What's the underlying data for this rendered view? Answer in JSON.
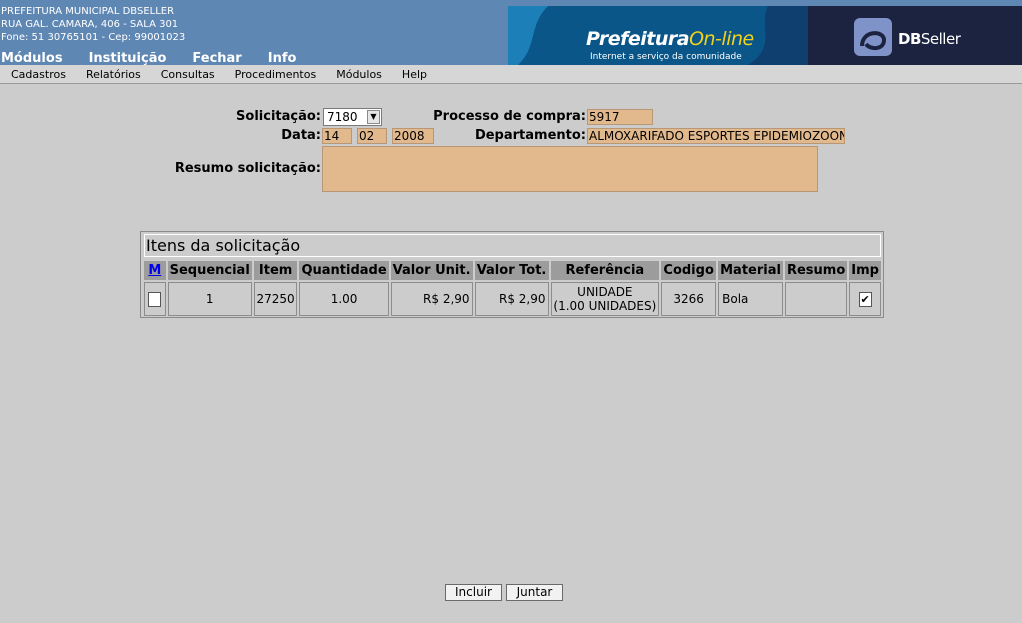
{
  "header": {
    "org_lines": [
      "PREFEITURA MUNICIPAL DBSELLER",
      "RUA GAL. CAMARA, 406 - SALA 301",
      "Fone: 51 30765101  -  Cep: 99001023"
    ],
    "nav": [
      "Módulos",
      "Instituição",
      "Fechar",
      "Info"
    ],
    "banner_title_main": "Prefeitura",
    "banner_title_accent": "On-line",
    "banner_subtitle": "Internet a serviço da comunidade",
    "brand_db": "DB",
    "brand_seller": "Seller"
  },
  "menu": [
    "Cadastros",
    "Relatórios",
    "Consultas",
    "Procedimentos",
    "Módulos",
    "Help"
  ],
  "form": {
    "solicitacao_label": "Solicitação:",
    "solicitacao_value": "7180",
    "processo_label": "Processo de compra:",
    "processo_value": "5917",
    "data_label": "Data:",
    "data_day": "14",
    "data_month": "02",
    "data_year": "2008",
    "departamento_label": "Departamento:",
    "departamento_value": "ALMOXARIFADO ESPORTES EPIDEMIOZOON",
    "resumo_label": "Resumo solicitação:",
    "resumo_value": ""
  },
  "items": {
    "title": "Itens da solicitação",
    "columns": [
      "M",
      "Sequencial",
      "Item",
      "Quantidade",
      "Valor Unit.",
      "Valor Tot.",
      "Referência",
      "Codigo",
      "Material",
      "Resumo",
      "Imp"
    ],
    "rows": [
      {
        "sequencial": "1",
        "item": "27250",
        "quantidade": "1.00",
        "valor_unit": "R$ 2,90",
        "valor_tot": "R$ 2,90",
        "referencia_1": "UNIDADE",
        "referencia_2": "(1.00 UNIDADES)",
        "codigo": "3266",
        "material": "Bola",
        "resumo": "",
        "m_checked": "",
        "imp_checked": "✔"
      }
    ]
  },
  "buttons": {
    "incluir": "Incluir",
    "juntar": "Juntar"
  }
}
